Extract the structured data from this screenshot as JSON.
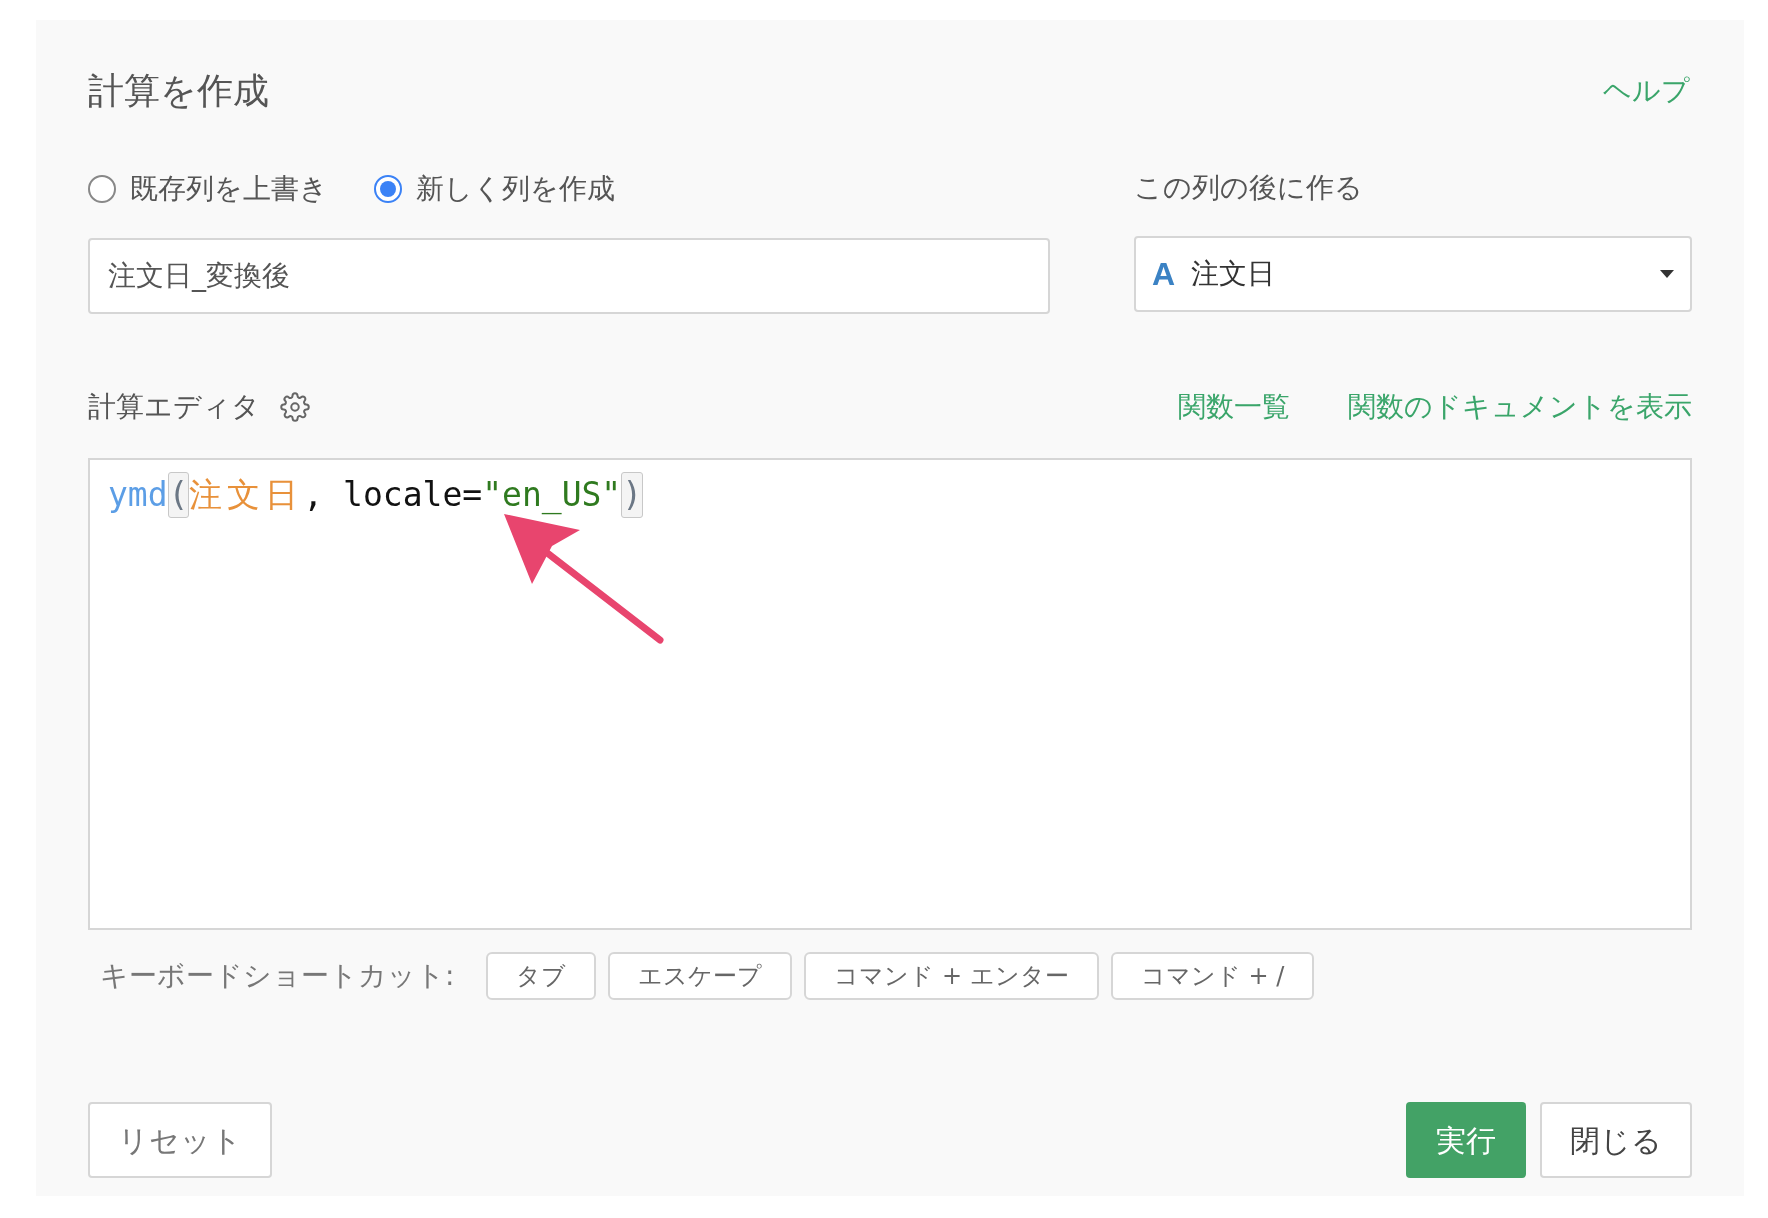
{
  "dialog": {
    "title": "計算を作成",
    "help_link": "ヘルプ"
  },
  "mode_options": [
    {
      "label": "既存列を上書き",
      "selected": false
    },
    {
      "label": "新しく列を作成",
      "selected": true
    }
  ],
  "column_name": {
    "value": "注文日_変換後"
  },
  "insert_after": {
    "label": "この列の後に作る",
    "type_icon": "A",
    "value": "注文日"
  },
  "editor": {
    "label": "計算エディタ",
    "links": [
      "関数一覧",
      "関数のドキュメントを表示"
    ],
    "tokens": [
      {
        "kind": "function",
        "text": "ymd"
      },
      {
        "kind": "bracket",
        "text": "("
      },
      {
        "kind": "column",
        "text": "注文日"
      },
      {
        "kind": "plain",
        "text": ", locale="
      },
      {
        "kind": "string",
        "text": "\"en_US\""
      },
      {
        "kind": "bracket",
        "text": ")"
      }
    ]
  },
  "shortcuts": {
    "label": "キーボードショートカット:",
    "keys": [
      "タブ",
      "エスケープ",
      "コマンド + エンター",
      "コマンド + /"
    ]
  },
  "buttons": {
    "reset": "リセット",
    "run": "実行",
    "close": "閉じる"
  }
}
